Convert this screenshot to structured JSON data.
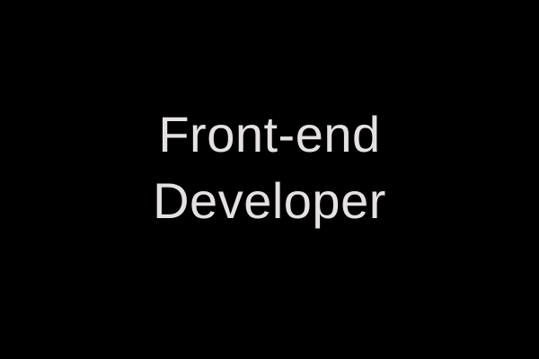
{
  "title": {
    "line1": "Front-end",
    "line2": "Developer"
  },
  "colors": {
    "background": "#000000",
    "text": "#e6e1e1"
  }
}
